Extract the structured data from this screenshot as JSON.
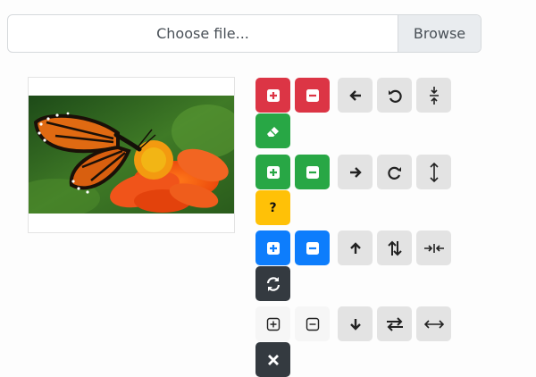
{
  "file_input": {
    "placeholder": "Choose file...",
    "browse_label": "Browse"
  },
  "preview": {
    "image": "monarch-butterfly-on-orange-flower"
  },
  "toolbar": {
    "help_label": "?"
  },
  "colors": {
    "danger": "#dc3545",
    "success": "#28a745",
    "warning": "#ffc107",
    "primary": "#0d7dfc",
    "dark": "#343a40",
    "secondary": "#e3e3e3"
  }
}
